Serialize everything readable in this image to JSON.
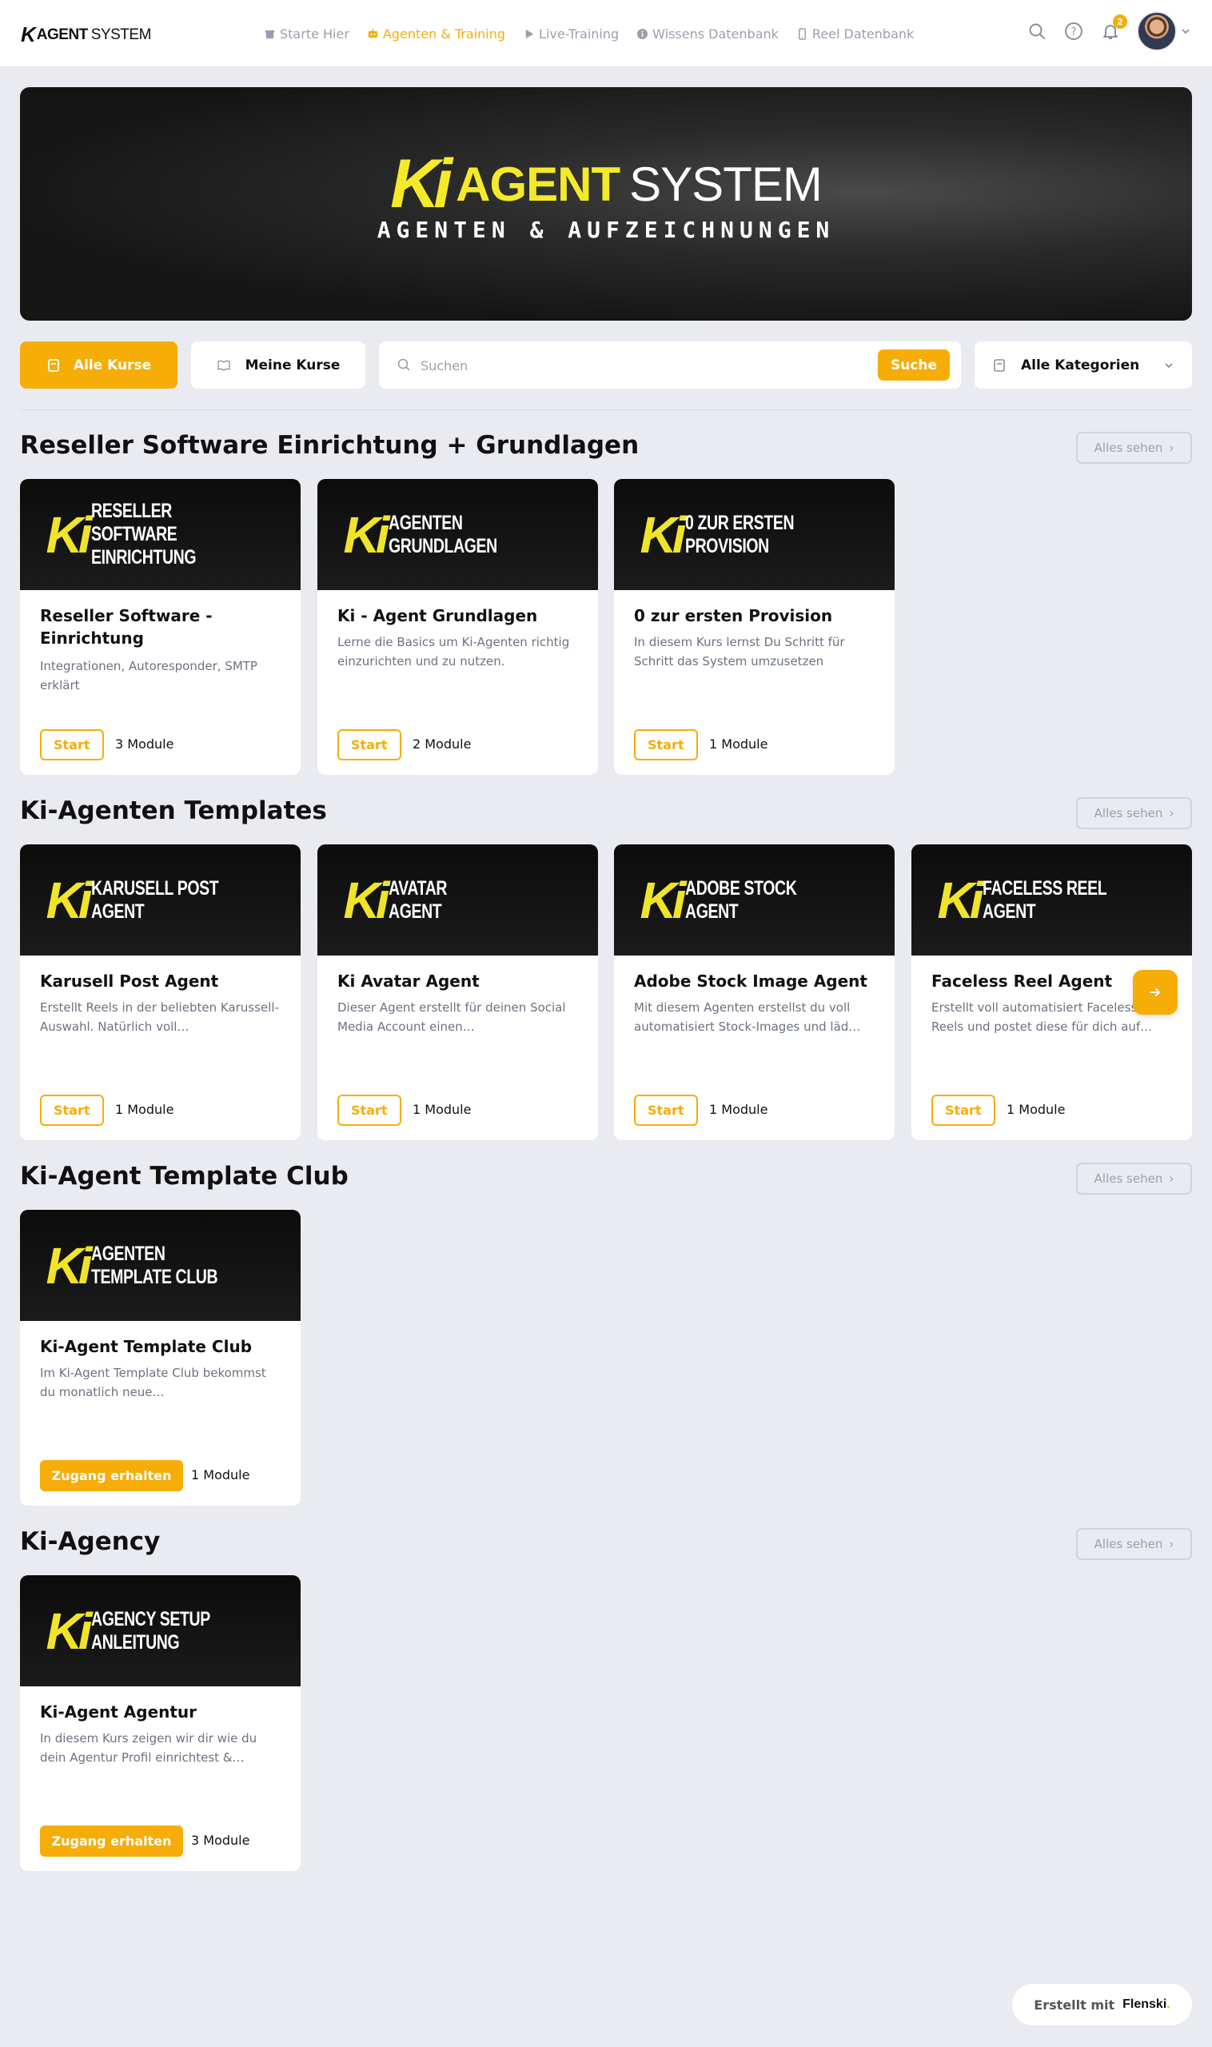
{
  "brand": {
    "logo_k": "K",
    "logo_agent": "AGENT",
    "logo_system": "SYSTEM"
  },
  "nav": [
    {
      "label": "Starte Hier",
      "icon": "store-icon",
      "active": false
    },
    {
      "label": "Agenten & Training",
      "icon": "robot-icon",
      "active": true
    },
    {
      "label": "Live-Training",
      "icon": "play-icon",
      "active": false
    },
    {
      "label": "Wissens Datenbank",
      "icon": "info-icon",
      "active": false
    },
    {
      "label": "Reel Datenbank",
      "icon": "phone-icon",
      "active": false
    }
  ],
  "header": {
    "notification_count": "2"
  },
  "hero": {
    "ki": "Ki",
    "agent": "AGENT",
    "system": "SYSTEM",
    "subtitle": "AGENTEN & AUFZEICHNUNGEN"
  },
  "filters": {
    "all_courses": "Alle Kurse",
    "my_courses": "Meine Kurse",
    "search_placeholder": "Suchen",
    "search_button": "Suche",
    "category": "Alle Kategorien"
  },
  "see_all_label": "Alles sehen",
  "sections": [
    {
      "title": "Reseller Software Einrichtung + Grundlagen",
      "courses": [
        {
          "thumb_label": "RESELLER SOFTWARE\nEINRICHTUNG",
          "title": "Reseller Software - Einrichtung",
          "desc": "Integrationen, Autoresponder, SMTP erklärt",
          "action": "Start",
          "modules": "3 Module"
        },
        {
          "thumb_label": "AGENTEN\nGRUNDLAGEN",
          "title": "Ki - Agent Grundlagen",
          "desc": "Lerne die Basics um Ki-Agenten richtig einzurichten und zu nutzen.",
          "action": "Start",
          "modules": "2 Module"
        },
        {
          "thumb_label": "0 ZUR ERSTEN\nPROVISION",
          "title": "0 zur ersten Provision",
          "desc": "In diesem Kurs lernst Du Schritt für Schritt das System umzusetzen",
          "action": "Start",
          "modules": "1 Module"
        }
      ]
    },
    {
      "title": "Ki-Agenten Templates",
      "courses": [
        {
          "thumb_label": "KARUSELL POST\nAGENT",
          "title": "Karusell Post Agent",
          "desc": "Erstellt Reels in der beliebten Karussell-Auswahl. Natürlich voll…",
          "action": "Start",
          "modules": "1 Module"
        },
        {
          "thumb_label": "AVATAR\nAGENT",
          "title": "Ki Avatar Agent",
          "desc": "Dieser Agent erstellt für deinen Social Media Account einen…",
          "action": "Start",
          "modules": "1 Module"
        },
        {
          "thumb_label": "ADOBE STOCK\nAGENT",
          "title": "Adobe Stock Image Agent",
          "desc": "Mit diesem Agenten erstellst du voll automatisiert Stock-Images und läd…",
          "action": "Start",
          "modules": "1 Module"
        },
        {
          "thumb_label": "FACELESS REEL\nAGENT",
          "title": "Faceless Reel Agent",
          "desc": "Erstellt voll automatisiert Faceless Reels und postet diese für dich auf…",
          "action": "Start",
          "modules": "1 Module"
        }
      ]
    },
    {
      "title": "Ki-Agent Template Club",
      "courses": [
        {
          "thumb_label": "AGENTEN\nTEMPLATE CLUB",
          "title": "Ki-Agent Template Club",
          "desc": "Im Ki-Agent Template Club bekommst du monatlich neue…",
          "action": "Zugang erhalten",
          "modules": "1 Module"
        }
      ]
    },
    {
      "title": "Ki-Agency",
      "courses": [
        {
          "thumb_label": "AGENCY SETUP\nANLEITUNG",
          "title": "Ki-Agent Agentur",
          "desc": "In diesem Kurs zeigen wir dir wie du dein Agentur Profil einrichtest &…",
          "action": "Zugang erhalten",
          "modules": "3 Module"
        }
      ]
    }
  ],
  "footer": {
    "label": "Erstellt mit",
    "brand": "Flenski",
    "dot": "."
  },
  "colors": {
    "accent": "#f6ad08",
    "background": "#e9ebf0",
    "thumb_yellow": "#f0e42a"
  }
}
